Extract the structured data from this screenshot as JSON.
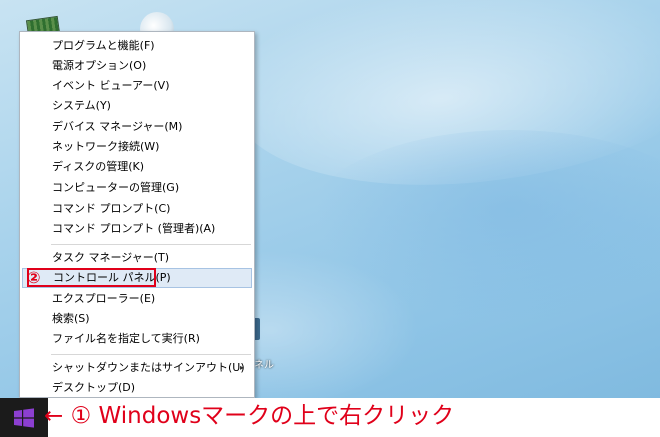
{
  "menu": {
    "items": [
      "プログラムと機能(F)",
      "電源オプション(O)",
      "イベント ビューアー(V)",
      "システム(Y)",
      "デバイス マネージャー(M)",
      "ネットワーク接続(W)",
      "ディスクの管理(K)",
      "コンピューターの管理(G)",
      "コマンド プロンプト(C)",
      "コマンド プロンプト (管理者)(A)",
      "タスク マネージャー(T)",
      "コントロール パネル(P)",
      "エクスプローラー(E)",
      "検索(S)",
      "ファイル名を指定して実行(R)",
      "シャットダウンまたはサインアウト(U)",
      "デスクトップ(D)"
    ],
    "submenu_arrow": "▸"
  },
  "annotations": {
    "step2": "②",
    "step1": "← ① Windowsマークの上で右クリック",
    "accent_color": "#e0001a"
  },
  "desktop": {
    "label_right": "ネル"
  },
  "icons": {
    "start": "windows-logo-icon",
    "submenu": "chevron-right-icon"
  }
}
